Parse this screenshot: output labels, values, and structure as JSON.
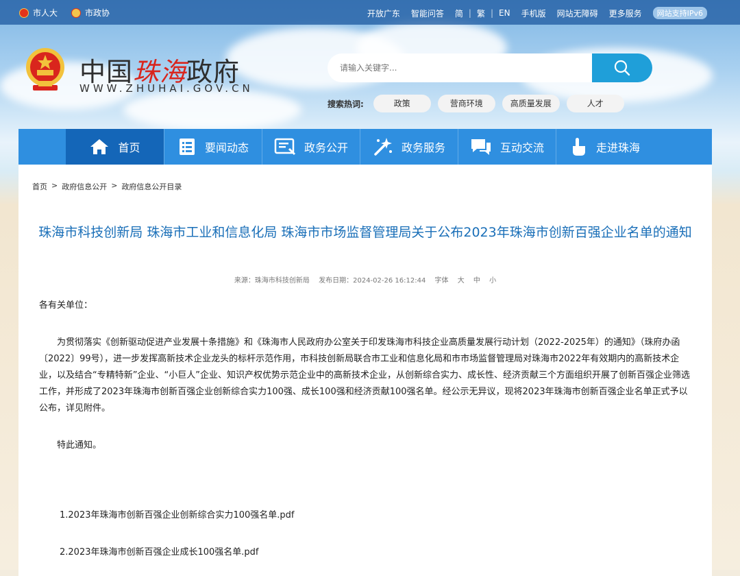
{
  "topbar": {
    "left": [
      "市人大",
      "市政协"
    ],
    "right": [
      "开放广东",
      "智能问答"
    ],
    "lang": [
      "简",
      "繁",
      "EN"
    ],
    "right2": [
      "手机版",
      "网站无障碍",
      "更多服务"
    ],
    "ipv6": "网站支持IPv6"
  },
  "logo": {
    "cn1": "中国",
    "cn2": "珠海",
    "cn3": "政府",
    "url": "WWW.ZHUHAI.GOV.CN"
  },
  "search": {
    "placeholder": "请输入关键字..."
  },
  "hot": {
    "label": "搜索热词:",
    "tags": [
      "政策",
      "营商环境",
      "高质量发展",
      "人才"
    ]
  },
  "nav": [
    "首页",
    "要闻动态",
    "政务公开",
    "政务服务",
    "互动交流",
    "走进珠海"
  ],
  "breadcrumb": [
    "首页",
    ">",
    "政府信息公开",
    ">",
    "政府信息公开目录"
  ],
  "article": {
    "title": "珠海市科技创新局 珠海市工业和信息化局 珠海市市场监督管理局关于公布2023年珠海市创新百强企业名单的通知",
    "source": "来源：珠海市科技创新局",
    "date": "发布日期：2024-02-26 16:12:44",
    "font_label": "字体",
    "font_sizes": [
      "大",
      "中",
      "小"
    ],
    "salutation": "各有关单位：",
    "paragraph": "为贯彻落实《创新驱动促进产业发展十条措施》和《珠海市人民政府办公室关于印发珠海市科技企业高质量发展行动计划（2022-2025年）的通知》（珠府办函〔2022〕99号），进一步发挥高新技术企业龙头的标杆示范作用，市科技创新局联合市工业和信息化局和市市场监督管理局对珠海市2022年有效期内的高新技术企业，以及结合“专精特新”企业、“小巨人”企业、知识产权优势示范企业中的高新技术企业，从创新综合实力、成长性、经济贡献三个方面组织开展了创新百强企业筛选工作，并形成了2023年珠海市创新百强企业创新综合实力100强、成长100强和经济贡献100强名单。经公示无异议，现将2023年珠海市创新百强企业名单正式予以公布，详见附件。",
    "notice": "特此通知。",
    "attachments": [
      "1.2023年珠海市创新百强企业创新综合实力100强名单.pdf",
      "2.2023年珠海市创新百强企业成长100强名单.pdf"
    ]
  },
  "colors": {
    "nav": "#2f8fe0",
    "nav_active": "#1466b8",
    "title": "#1a6fb8",
    "search_btn": "#1f9fd9"
  },
  "icons": [
    "national-emblem-icon",
    "search-icon",
    "home-icon",
    "news-icon",
    "open-info-icon",
    "service-icon",
    "chat-icon",
    "hand-icon"
  ]
}
